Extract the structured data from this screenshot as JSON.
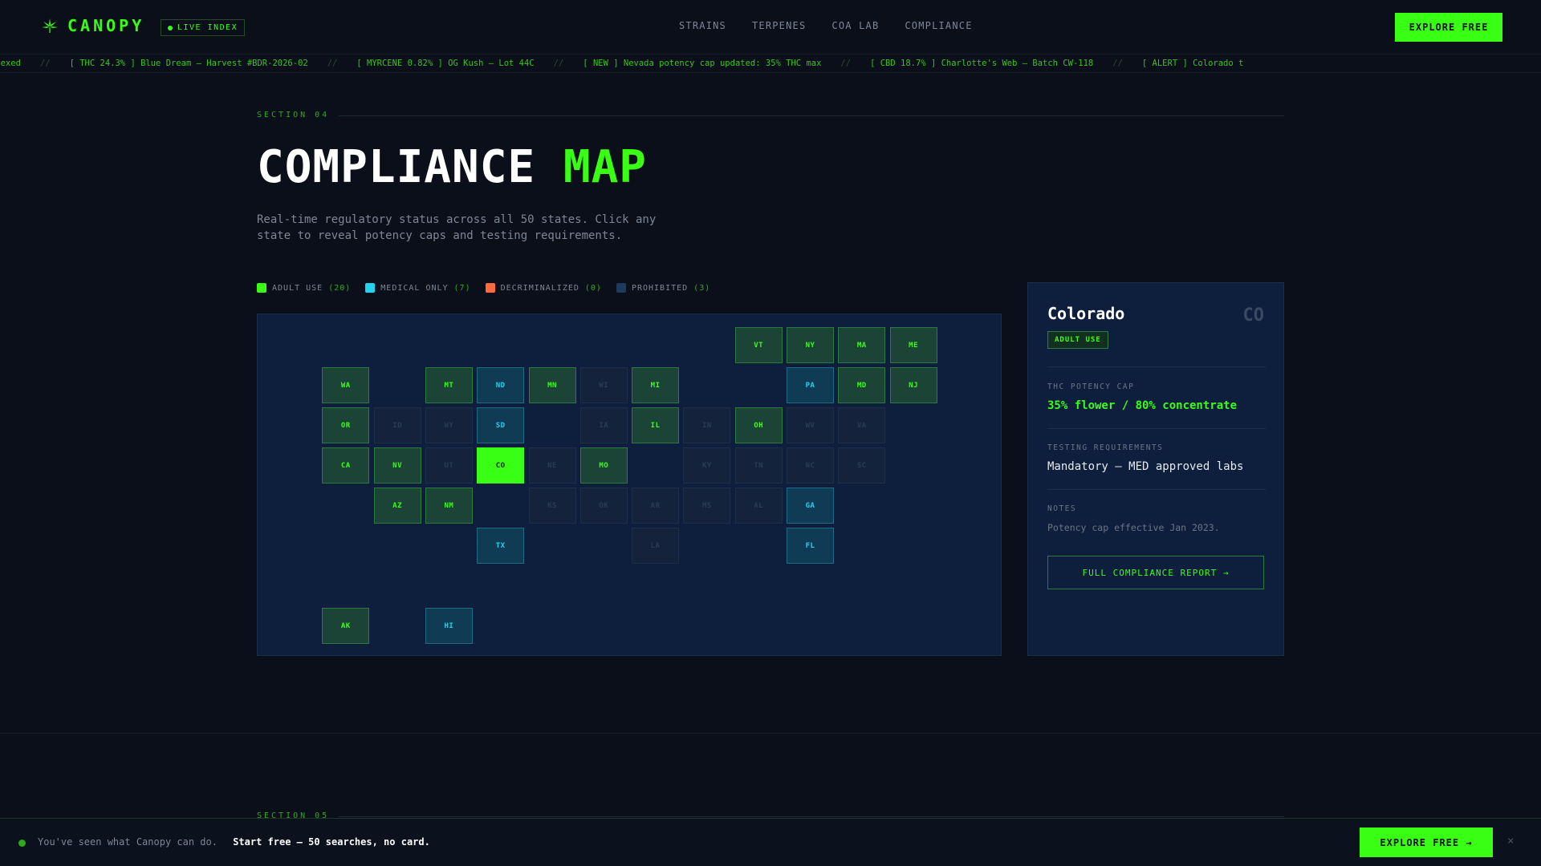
{
  "header": {
    "logo_text": "CANOPY",
    "live_badge": "LIVE INDEX",
    "nav": [
      "STRAINS",
      "TERPENES",
      "COA LAB",
      "COMPLIANCE"
    ],
    "cta": "EXPLORE FREE"
  },
  "ticker": [
    "ndexed",
    "[ THC 24.3% ] Blue Dream — Harvest #BDR-2026-02",
    "[ MYRCENE 0.82% ] OG Kush — Lot 44C",
    "[ NEW ] Nevada potency cap updated: 35% THC max",
    "[ CBD 18.7% ] Charlotte's Web — Batch CW-118",
    "[ ALERT ] Colorado t"
  ],
  "ticker_separator": "//",
  "section": {
    "label": "SECTION 04",
    "title_main": "COMPLIANCE",
    "title_accent": "MAP",
    "subtitle": "Real-time regulatory status across all 50 states. Click any state to reveal potency caps and testing requirements."
  },
  "legend": [
    {
      "label": "ADULT USE",
      "count": "(20)",
      "color": "#39ff14"
    },
    {
      "label": "MEDICAL ONLY",
      "count": "(7)",
      "color": "#22d3ee"
    },
    {
      "label": "DECRIMINALIZED",
      "count": "(0)",
      "color": "#ff6b3d"
    },
    {
      "label": "PROHIBITED",
      "count": "(3)",
      "color": "#1e3a5f"
    }
  ],
  "states": [
    {
      "code": "VT",
      "status": "adult"
    },
    {
      "code": "NY",
      "status": "adult"
    },
    {
      "code": "MA",
      "status": "adult"
    },
    {
      "code": "ME",
      "status": "adult"
    },
    {
      "code": "WA",
      "status": "adult"
    },
    {
      "code": "MT",
      "status": "adult"
    },
    {
      "code": "ND",
      "status": "medical"
    },
    {
      "code": "MN",
      "status": "adult"
    },
    {
      "code": "WI",
      "status": "prohibited"
    },
    {
      "code": "MI",
      "status": "adult"
    },
    {
      "code": "PA",
      "status": "medical"
    },
    {
      "code": "MD",
      "status": "adult"
    },
    {
      "code": "NJ",
      "status": "adult"
    },
    {
      "code": "OR",
      "status": "adult"
    },
    {
      "code": "ID",
      "status": "prohibited"
    },
    {
      "code": "WY",
      "status": "prohibited"
    },
    {
      "code": "SD",
      "status": "medical"
    },
    {
      "code": "IA",
      "status": "prohibited"
    },
    {
      "code": "IL",
      "status": "adult"
    },
    {
      "code": "IN",
      "status": "prohibited"
    },
    {
      "code": "OH",
      "status": "adult"
    },
    {
      "code": "WV",
      "status": "prohibited"
    },
    {
      "code": "VA",
      "status": "prohibited"
    },
    {
      "code": "CA",
      "status": "adult"
    },
    {
      "code": "NV",
      "status": "adult"
    },
    {
      "code": "UT",
      "status": "prohibited"
    },
    {
      "code": "CO",
      "status": "selected"
    },
    {
      "code": "NE",
      "status": "prohibited"
    },
    {
      "code": "MO",
      "status": "adult"
    },
    {
      "code": "KY",
      "status": "prohibited"
    },
    {
      "code": "TN",
      "status": "prohibited"
    },
    {
      "code": "NC",
      "status": "prohibited"
    },
    {
      "code": "SC",
      "status": "prohibited"
    },
    {
      "code": "AZ",
      "status": "adult"
    },
    {
      "code": "NM",
      "status": "adult"
    },
    {
      "code": "KS",
      "status": "prohibited"
    },
    {
      "code": "OK",
      "status": "prohibited"
    },
    {
      "code": "AR",
      "status": "prohibited"
    },
    {
      "code": "MS",
      "status": "prohibited"
    },
    {
      "code": "AL",
      "status": "prohibited"
    },
    {
      "code": "GA",
      "status": "medical"
    },
    {
      "code": "TX",
      "status": "medical"
    },
    {
      "code": "LA",
      "status": "prohibited"
    },
    {
      "code": "FL",
      "status": "medical"
    },
    {
      "code": "AK",
      "status": "adult"
    },
    {
      "code": "HI",
      "status": "medical"
    }
  ],
  "panel": {
    "state": "Colorado",
    "code": "CO",
    "badge": "ADULT USE",
    "thc_label": "THC POTENCY CAP",
    "thc_value": "35% flower / 80% concentrate",
    "testing_label": "TESTING REQUIREMENTS",
    "testing_value": "Mandatory — MED approved labs",
    "notes_label": "NOTES",
    "notes_value": "Potency cap effective Jan 2023.",
    "button": "FULL COMPLIANCE REPORT →"
  },
  "next_section_label": "SECTION 05",
  "bottom_bar": {
    "text": "You've seen what Canopy can do.",
    "strong": "Start free — 50 searches, no card.",
    "cta": "EXPLORE FREE →",
    "close": "×"
  },
  "colors": {
    "accent": "#39ff14",
    "medical": "#22d3ee",
    "background": "#0a0f1a"
  }
}
